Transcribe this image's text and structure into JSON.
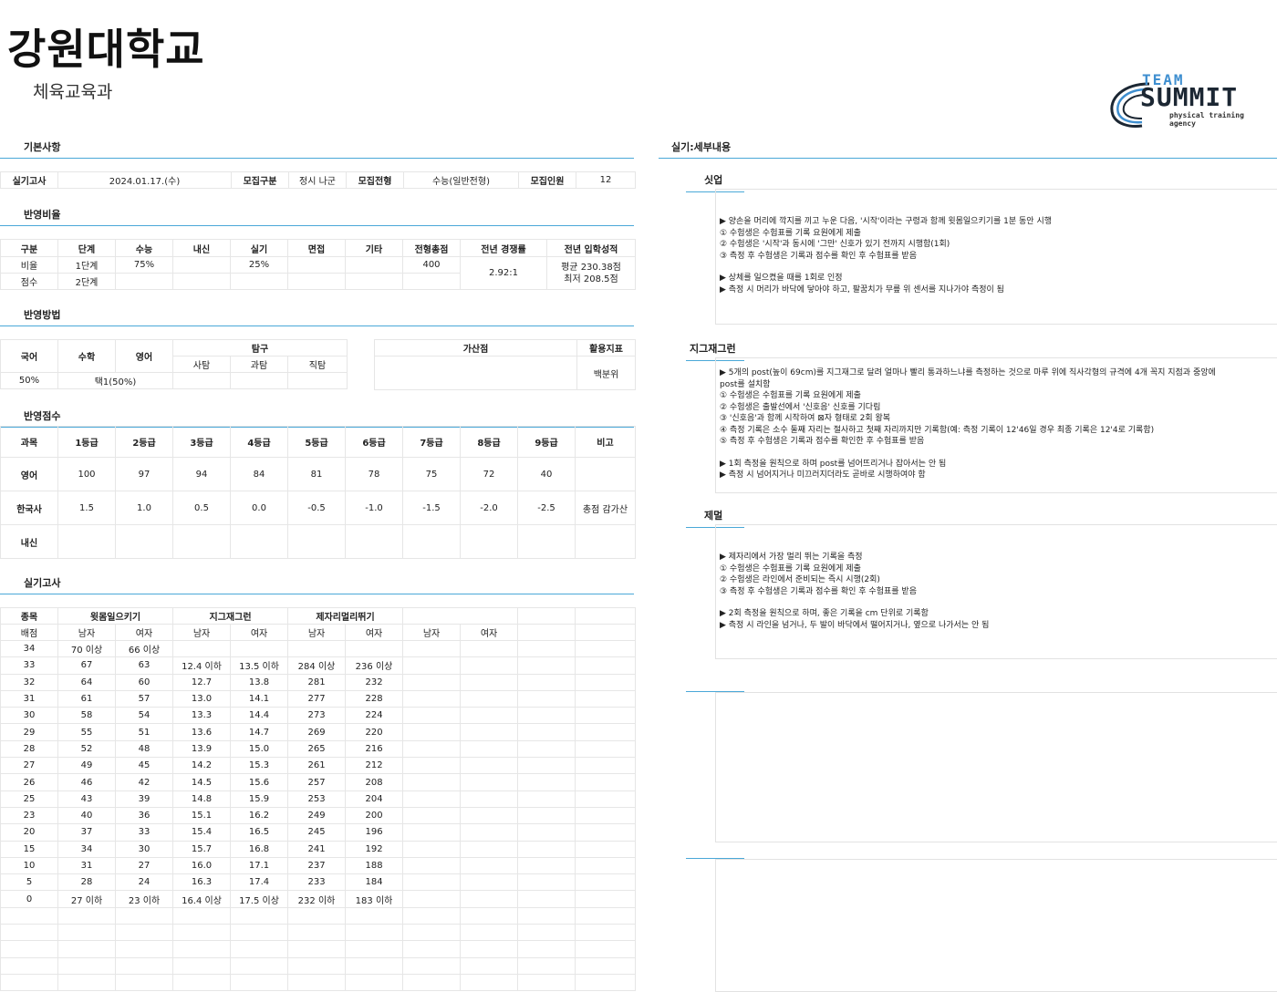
{
  "header": {
    "title": "강원대학교",
    "subtitle": "체육교육과"
  },
  "logo": {
    "team": "TEAM",
    "name": "SUMMIT",
    "tagline": "physical training agency"
  },
  "sections": {
    "basic": "기본사항",
    "ratio": "반영비율",
    "method": "반영방법",
    "score": "반영점수",
    "exam": "실기고사",
    "detail": "실기:세부내용"
  },
  "basic": {
    "labels": [
      "실기고사",
      "모집구분",
      "모집전형",
      "모집인원"
    ],
    "date": "2024.01.17.(수)",
    "type": "정시 나군",
    "track": "수능(일반전형)",
    "count": "12"
  },
  "ratio": {
    "headers": [
      "구분",
      "단계",
      "수능",
      "내신",
      "실기",
      "면접",
      "기타",
      "전형총점",
      "전년 경쟁률",
      "전년 입학성적"
    ],
    "rows": [
      [
        "비율",
        "1단계",
        "75%",
        "",
        "25%",
        "",
        "",
        "400"
      ],
      [
        "점수",
        "2단계",
        "",
        "",
        "",
        "",
        "",
        ""
      ]
    ],
    "competition": "2.92:1",
    "admit1": "평균 230.38점",
    "admit2": "최저 208.5점"
  },
  "method": {
    "korean": "국어",
    "math": "수학",
    "english": "영어",
    "inquiry": "탐구",
    "sub": [
      "사탐",
      "과탐",
      "직탐"
    ],
    "bonus": "가산점",
    "index": "활용지표",
    "korean_val": "50%",
    "math_val": "택1(50%)",
    "index_val": "백분위"
  },
  "score": {
    "headers": [
      "과목",
      "1등급",
      "2등급",
      "3등급",
      "4등급",
      "5등급",
      "6등급",
      "7등급",
      "8등급",
      "9등급",
      "비고"
    ],
    "rows": [
      [
        "영어",
        "100",
        "97",
        "94",
        "84",
        "81",
        "78",
        "75",
        "72",
        "40",
        ""
      ],
      [
        "한국사",
        "1.5",
        "1.0",
        "0.5",
        "0.0",
        "-0.5",
        "-1.0",
        "-1.5",
        "-2.0",
        "-2.5",
        "총점 감가산"
      ],
      [
        "내신",
        "",
        "",
        "",
        "",
        "",
        "",
        "",
        "",
        "",
        ""
      ]
    ]
  },
  "exam": {
    "h1": [
      "종목",
      "윗몸일으키기",
      "지그재그런",
      "제자리멀리뛰기"
    ],
    "h2": [
      "배점",
      "남자",
      "여자",
      "남자",
      "여자",
      "남자",
      "여자",
      "남자",
      "여자"
    ],
    "rows": [
      [
        "34",
        "70 이상",
        "66 이상",
        "",
        "",
        "",
        "",
        "",
        ""
      ],
      [
        "33",
        "67",
        "63",
        "12.4 이하",
        "13.5 이하",
        "284 이상",
        "236 이상",
        "",
        ""
      ],
      [
        "32",
        "64",
        "60",
        "12.7",
        "13.8",
        "281",
        "232",
        "",
        ""
      ],
      [
        "31",
        "61",
        "57",
        "13.0",
        "14.1",
        "277",
        "228",
        "",
        ""
      ],
      [
        "30",
        "58",
        "54",
        "13.3",
        "14.4",
        "273",
        "224",
        "",
        ""
      ],
      [
        "29",
        "55",
        "51",
        "13.6",
        "14.7",
        "269",
        "220",
        "",
        ""
      ],
      [
        "28",
        "52",
        "48",
        "13.9",
        "15.0",
        "265",
        "216",
        "",
        ""
      ],
      [
        "27",
        "49",
        "45",
        "14.2",
        "15.3",
        "261",
        "212",
        "",
        ""
      ],
      [
        "26",
        "46",
        "42",
        "14.5",
        "15.6",
        "257",
        "208",
        "",
        ""
      ],
      [
        "25",
        "43",
        "39",
        "14.8",
        "15.9",
        "253",
        "204",
        "",
        ""
      ],
      [
        "23",
        "40",
        "36",
        "15.1",
        "16.2",
        "249",
        "200",
        "",
        ""
      ],
      [
        "20",
        "37",
        "33",
        "15.4",
        "16.5",
        "245",
        "196",
        "",
        ""
      ],
      [
        "15",
        "34",
        "30",
        "15.7",
        "16.8",
        "241",
        "192",
        "",
        ""
      ],
      [
        "10",
        "31",
        "27",
        "16.0",
        "17.1",
        "237",
        "188",
        "",
        ""
      ],
      [
        "5",
        "28",
        "24",
        "16.3",
        "17.4",
        "233",
        "184",
        "",
        ""
      ],
      [
        "0",
        "27 이하",
        "23 이하",
        "16.4 이상",
        "17.5 이상",
        "232 이하",
        "183 이하",
        "",
        ""
      ]
    ]
  },
  "detail": {
    "situp": {
      "title": "싯업",
      "lines": [
        "▶ 양손을 머리에 깍지를 끼고 누운 다음, '시작'이라는 구령과 함께 윗몸일으키기를 1분 동안 시행",
        "① 수험생은 수험표를 기록 요원에게 제출",
        "② 수험생은 '시작'과 동시에 '그만' 신호가 있기 전까지 시행함(1회)",
        "③ 측정 후 수험생은 기록과 점수를 확인 후 수험표를 받음",
        "",
        "▶ 상체를 일으켰을 때를 1회로 인정",
        "▶ 측정 시 머리가 바닥에 닿아야 하고, 팔꿈치가 무릎 위 센서를 지나가야 측정이 됨"
      ]
    },
    "zigzag": {
      "title": "지그재그런",
      "lines": [
        "▶ 5개의 post(높이 69cm)를 지그재그로 달려 얼마나 빨리 통과하느냐를 측정하는 것으로 마루 위에 직사각형의 규격에 4개 꼭지 지점과 중앙에",
        "post를 설치함",
        "① 수험생은 수험표를 기록 요원에게 제출",
        "② 수험생은 출발선에서 '신호음' 신호를 기다림",
        "③ '신호음'과 함께 시작하여 ⊠자 형태로 2회 왕복",
        "④ 측정 기록은 소수 둘째 자리는 절사하고 첫째 자리까지만 기록함(예: 측정 기록이 12'46일 경우 최종 기록은 12'4로 기록함)",
        "⑤ 측정 후 수험생은 기록과 점수를 확인한 후 수험표를 받음",
        "",
        "▶ 1회 측정을 원칙으로 하며 post를 넘어뜨리거나 잡아서는 안 됨",
        "▶ 측정 시 넘어지거나 미끄러지더라도 곧바로 시행하여야 함"
      ]
    },
    "jump": {
      "title": "제멀",
      "lines": [
        "▶ 제자리에서 가장 멀리 뛰는 기록을 측정",
        "① 수험생은 수험표를 기록 요원에게 제출",
        "② 수험생은 라인에서 준비되는 즉시 시행(2회)",
        "③ 측정 후 수험생은 기록과 점수를 확인 후 수험표를 받음",
        "",
        "▶ 2회 측정을 원칙으로 하며, 좋은 기록을 cm 단위로 기록함",
        "▶ 측정 시 라인을 넘거나, 두 발이 바닥에서 떨어지거나, 옆으로 나가서는 안 됨"
      ]
    }
  }
}
